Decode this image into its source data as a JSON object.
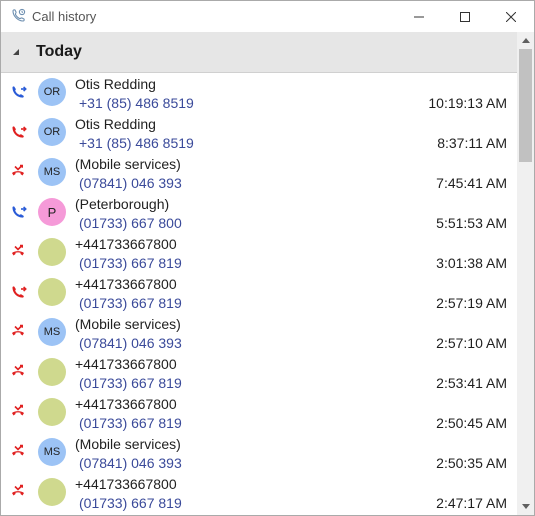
{
  "window": {
    "title": "Call history"
  },
  "group": {
    "title": "Today"
  },
  "colors": {
    "outgoing": "#2a5bd7",
    "missed": "#e02020",
    "avatar_blue": "#9cc3f5",
    "avatar_pink": "#f59ad8",
    "avatar_green": "#cfd98e"
  },
  "calls": [
    {
      "type": "outgoing",
      "avatar_initials": "OR",
      "avatar_color": "blue",
      "name": "Otis Redding",
      "number": "+31 (85) 486 8519",
      "time": "10:19:13 AM"
    },
    {
      "type": "missed-callback",
      "avatar_initials": "OR",
      "avatar_color": "blue",
      "name": "Otis Redding",
      "number": "+31 (85) 486 8519",
      "time": "8:37:11 AM"
    },
    {
      "type": "missed",
      "avatar_initials": "MS",
      "avatar_color": "blue",
      "name": "(Mobile services)",
      "number": "(07841) 046 393",
      "time": "7:45:41 AM"
    },
    {
      "type": "outgoing",
      "avatar_initials": "P",
      "avatar_color": "pink",
      "name": "(Peterborough)",
      "number": "(01733) 667 800",
      "time": "5:51:53 AM"
    },
    {
      "type": "missed",
      "avatar_initials": "",
      "avatar_color": "green",
      "name": "+441733667800",
      "number": "(01733) 667 819",
      "time": "3:01:38 AM"
    },
    {
      "type": "missed-callback",
      "avatar_initials": "",
      "avatar_color": "green",
      "name": "+441733667800",
      "number": "(01733) 667 819",
      "time": "2:57:19 AM"
    },
    {
      "type": "missed",
      "avatar_initials": "MS",
      "avatar_color": "blue",
      "name": "(Mobile services)",
      "number": "(07841) 046 393",
      "time": "2:57:10 AM"
    },
    {
      "type": "missed",
      "avatar_initials": "",
      "avatar_color": "green",
      "name": "+441733667800",
      "number": "(01733) 667 819",
      "time": "2:53:41 AM"
    },
    {
      "type": "missed",
      "avatar_initials": "",
      "avatar_color": "green",
      "name": "+441733667800",
      "number": "(01733) 667 819",
      "time": "2:50:45 AM"
    },
    {
      "type": "missed",
      "avatar_initials": "MS",
      "avatar_color": "blue",
      "name": "(Mobile services)",
      "number": "(07841) 046 393",
      "time": "2:50:35 AM"
    },
    {
      "type": "missed",
      "avatar_initials": "",
      "avatar_color": "green",
      "name": "+441733667800",
      "number": "(01733) 667 819",
      "time": "2:47:17 AM"
    }
  ]
}
